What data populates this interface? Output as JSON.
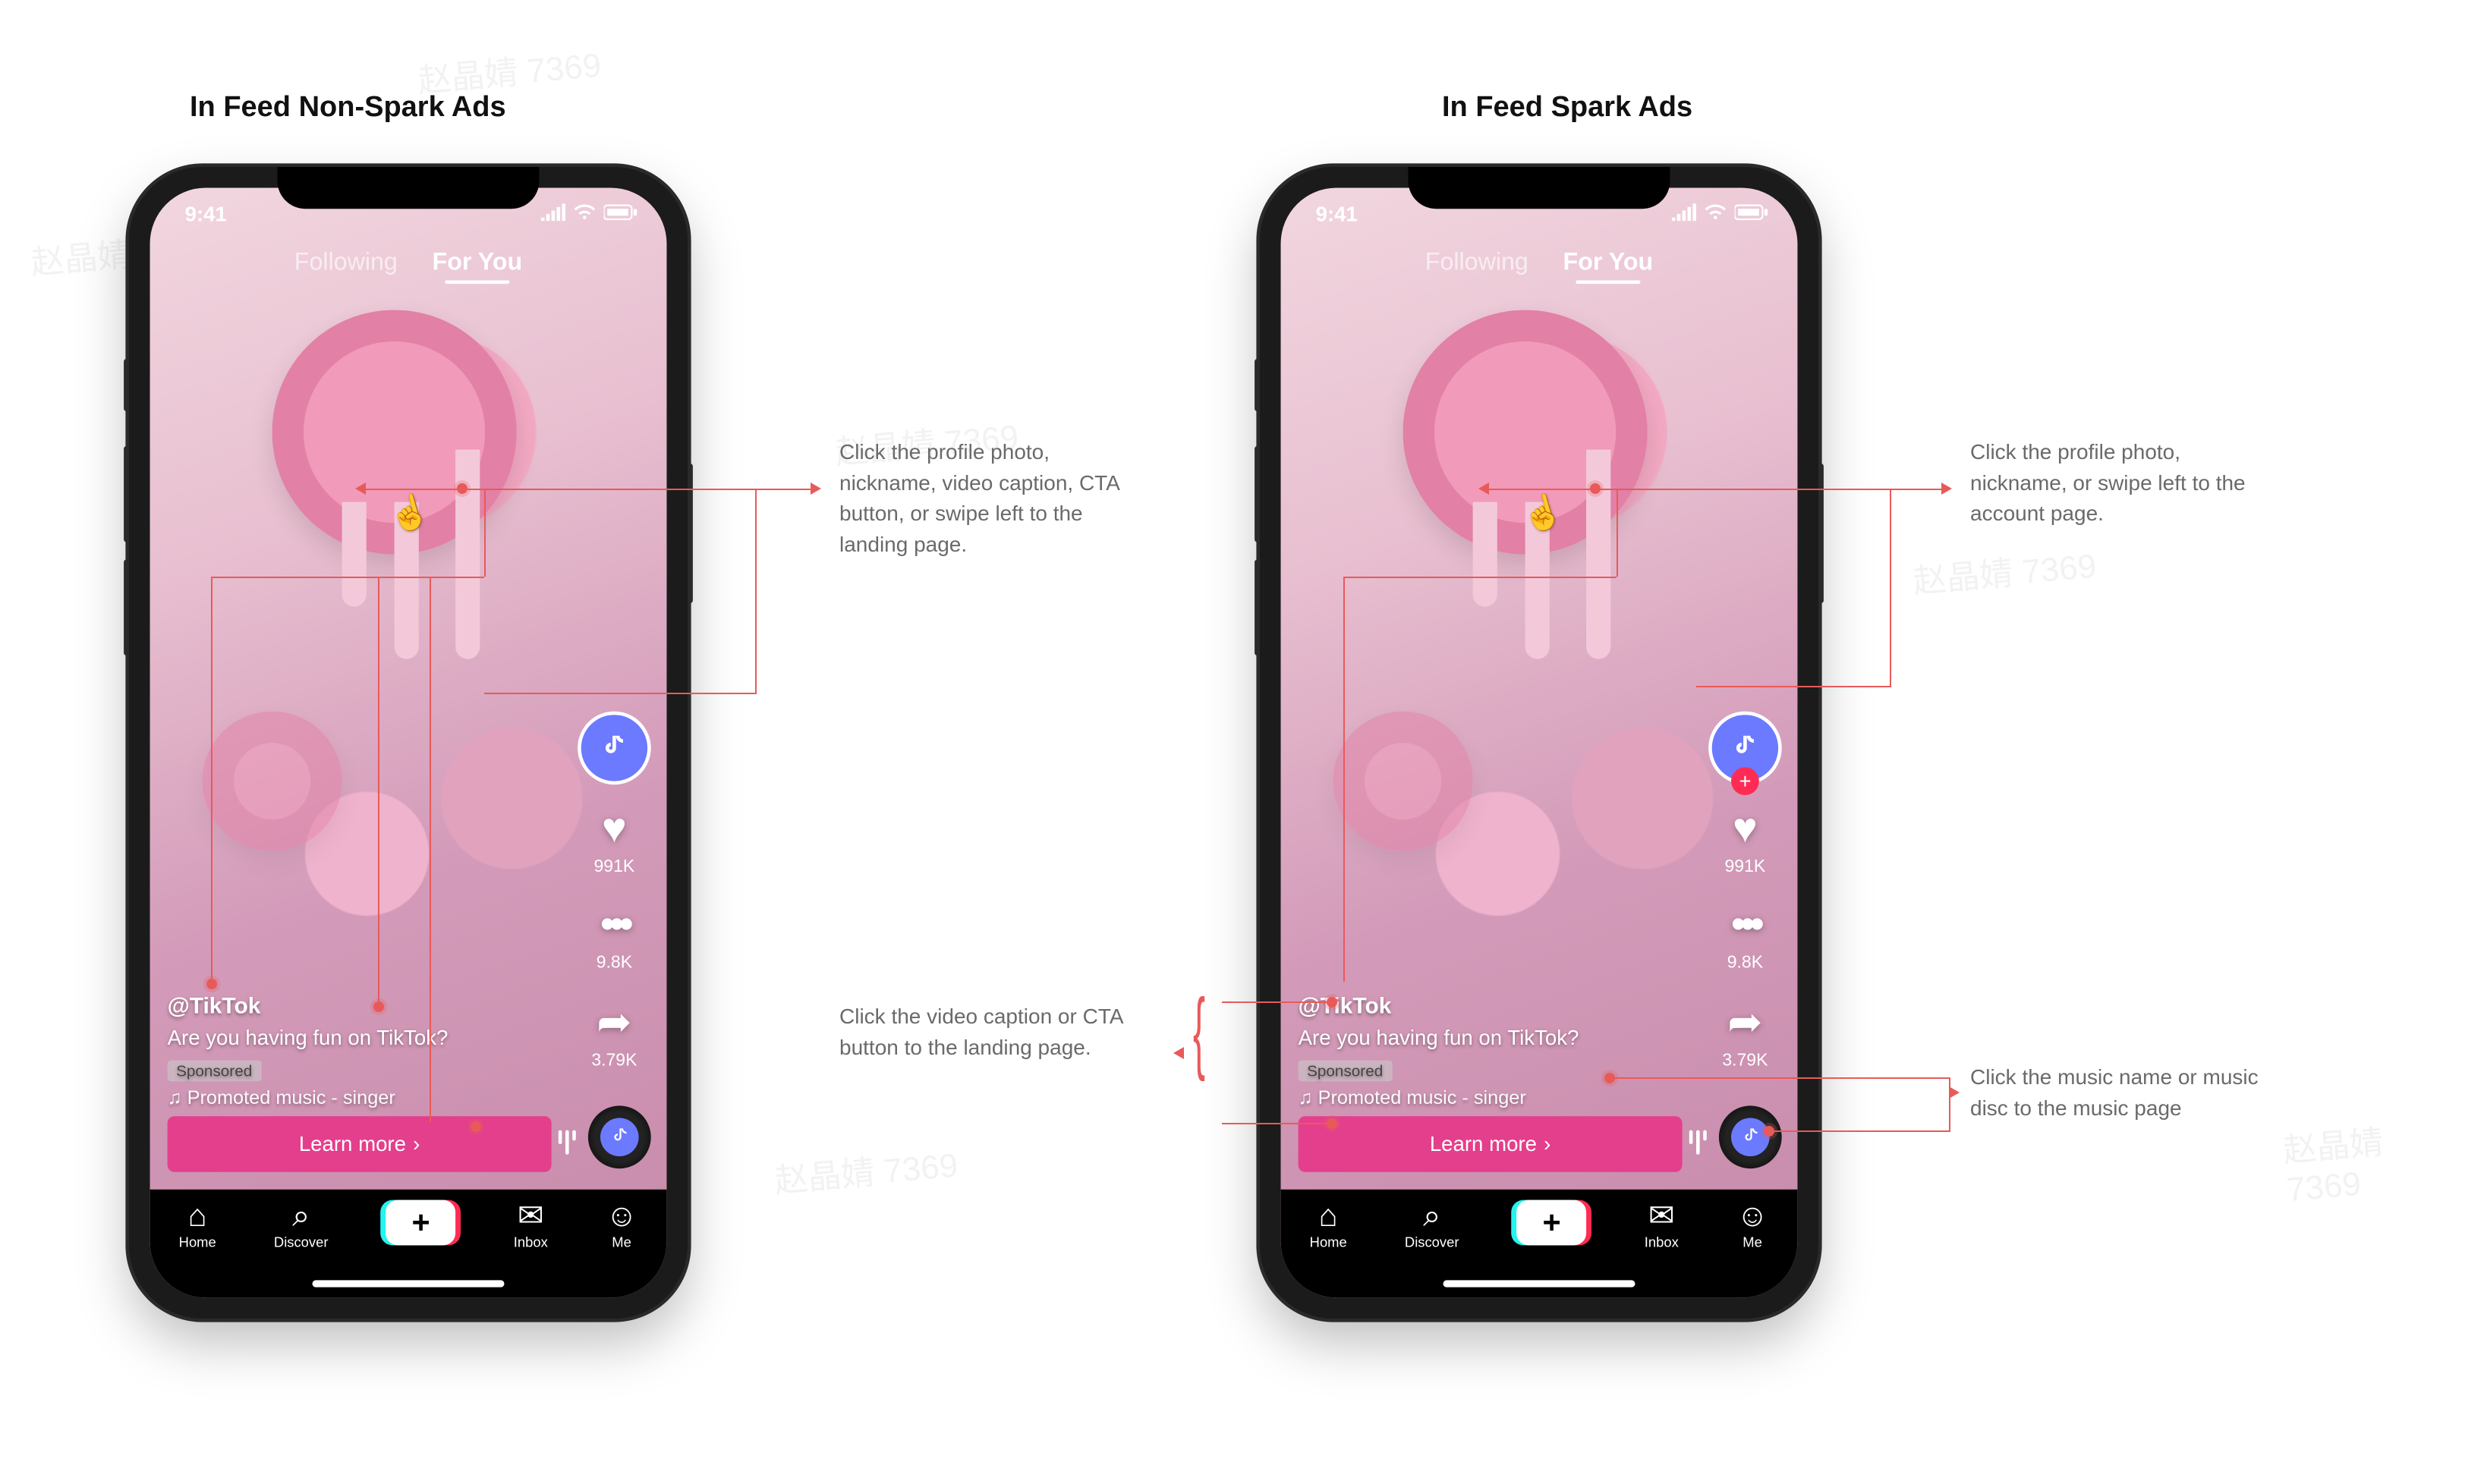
{
  "watermark": "赵晶婧 7369",
  "titles": {
    "left": "In Feed Non-Spark Ads",
    "right": "In Feed Spark Ads"
  },
  "status": {
    "time": "9:41"
  },
  "feed_tabs": {
    "following": "Following",
    "for_you": "For You"
  },
  "rail": {
    "likes": "991K",
    "comments": "9.8K",
    "shares": "3.79K"
  },
  "caption": {
    "username": "@TikTok",
    "text": "Are you having fun on TikTok?",
    "sponsored": "Sponsored",
    "music": "♫ Promoted music - singer"
  },
  "cta": {
    "label": "Learn more",
    "chevron": "›"
  },
  "bottom_nav": {
    "home": "Home",
    "discover": "Discover",
    "inbox": "Inbox",
    "me": "Me"
  },
  "annotations": {
    "left_top": "Click the profile photo, nickname, video caption, CTA button, or swipe left to the landing page.",
    "right_top": "Click the profile photo, nickname, or swipe left to the account page.",
    "right_mid": "Click the video caption or CTA button to the landing page.",
    "right_music": "Click the music name or music disc to the music page"
  },
  "left_phone": {
    "show_follow_plus": false
  },
  "right_phone": {
    "show_follow_plus": true
  }
}
